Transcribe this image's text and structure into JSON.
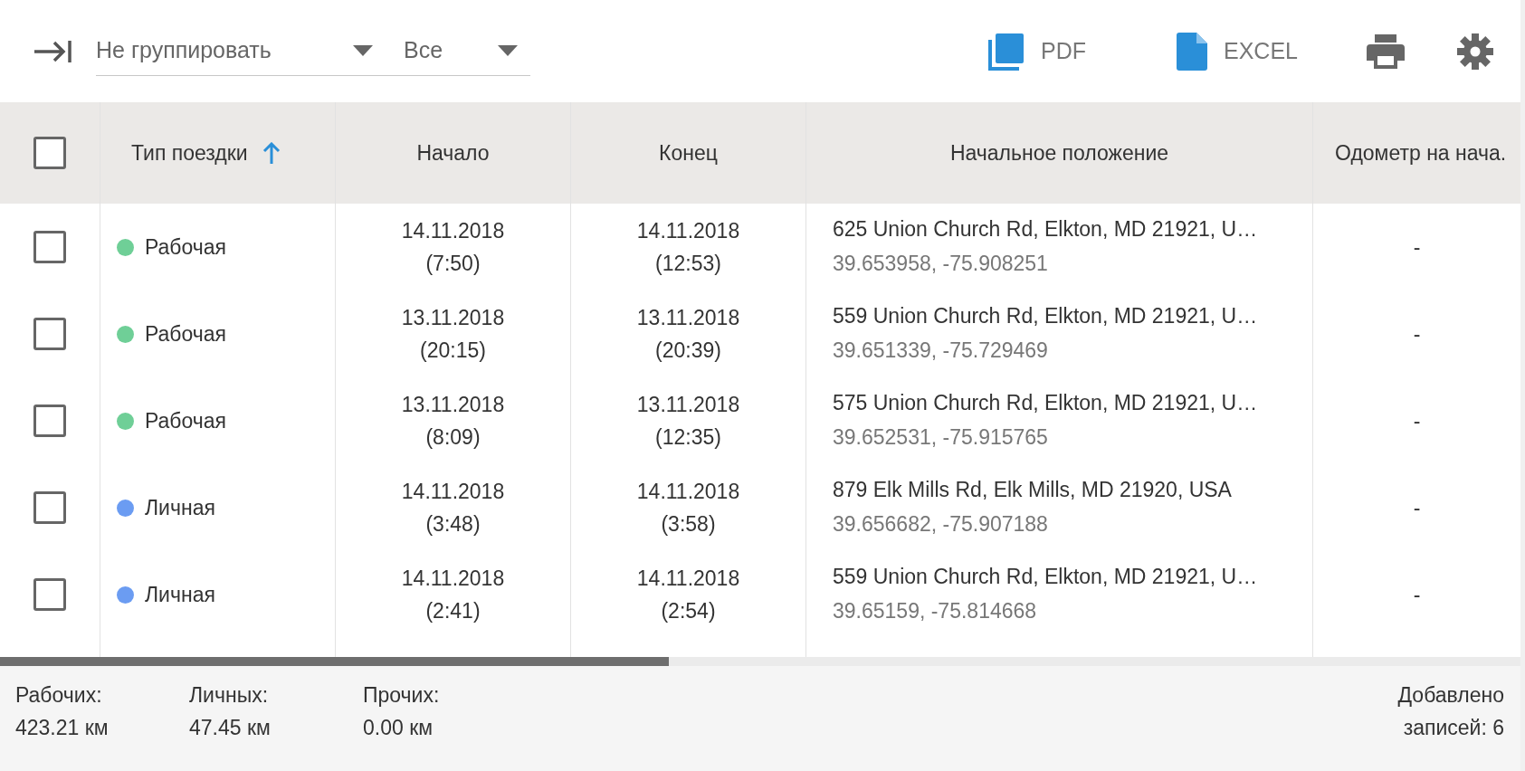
{
  "toolbar": {
    "group_select": {
      "value": "Не группировать"
    },
    "filter_select": {
      "value": "Все"
    },
    "buttons": [
      {
        "kind": "pdf",
        "label": "PDF"
      },
      {
        "kind": "excel",
        "label": "EXCEL"
      },
      {
        "kind": "print"
      },
      {
        "kind": "settings"
      }
    ]
  },
  "table": {
    "select_all": {
      "checked": false
    },
    "columns": [
      {
        "label": "Тип поездки",
        "sorted": true
      },
      {
        "label": "Начало",
        "sorted": false
      },
      {
        "label": "Конец",
        "sorted": false
      },
      {
        "label": "Начальное положение",
        "sorted": false
      },
      {
        "label": "Одометр на нача.",
        "sorted": false
      }
    ],
    "rows": [
      {
        "checked": false,
        "type": "Рабочая",
        "color": "#6fcf97",
        "start_date": "14.11.2018",
        "start_time": "(7:50)",
        "end_date": "14.11.2018",
        "end_time": "(12:53)",
        "address": "625 Union Church Rd, Elkton, MD 21921, U…",
        "coords": "39.653958, -75.908251",
        "odometer": "-"
      },
      {
        "checked": false,
        "type": "Рабочая",
        "color": "#6fcf97",
        "start_date": "13.11.2018",
        "start_time": "(20:15)",
        "end_date": "13.11.2018",
        "end_time": "(20:39)",
        "address": "559 Union Church Rd, Elkton, MD 21921, U…",
        "coords": "39.651339, -75.729469",
        "odometer": "-"
      },
      {
        "checked": false,
        "type": "Рабочая",
        "color": "#6fcf97",
        "start_date": "13.11.2018",
        "start_time": "(8:09)",
        "end_date": "13.11.2018",
        "end_time": "(12:35)",
        "address": "575 Union Church Rd, Elkton, MD 21921, U…",
        "coords": "39.652531, -75.915765",
        "odometer": "-"
      },
      {
        "checked": false,
        "type": "Личная",
        "color": "#6b9cf2",
        "start_date": "14.11.2018",
        "start_time": "(3:48)",
        "end_date": "14.11.2018",
        "end_time": "(3:58)",
        "address": "879 Elk Mills Rd, Elk Mills, MD 21920, USA",
        "coords": "39.656682, -75.907188",
        "odometer": "-"
      },
      {
        "checked": false,
        "type": "Личная",
        "color": "#6b9cf2",
        "start_date": "14.11.2018",
        "start_time": "(2:41)",
        "end_date": "14.11.2018",
        "end_time": "(2:54)",
        "address": "559 Union Church Rd, Elkton, MD 21921, U…",
        "coords": "39.65159, -75.814668",
        "odometer": "-"
      }
    ]
  },
  "footer": {
    "totals": [
      {
        "label": "Рабочих:",
        "value": "423.21 км"
      },
      {
        "label": "Личных:",
        "value": "47.45 км"
      },
      {
        "label": "Прочих:",
        "value": "0.00 км"
      }
    ],
    "records": "Добавлено\nзаписей: 6"
  }
}
